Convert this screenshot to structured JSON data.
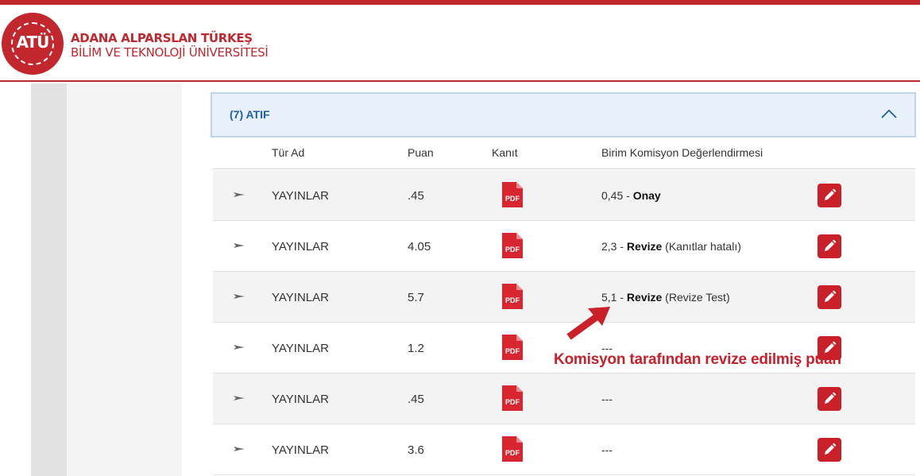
{
  "header": {
    "logo_text": "ATÜ",
    "university_line1": "ADANA ALPARSLAN TÜRKEŞ",
    "university_line2": "BİLİM VE TEKNOLOJİ ÜNİVERSİTESİ"
  },
  "panel": {
    "title": "(7) ATIF",
    "toggle_icon": "chevron-up-icon"
  },
  "table": {
    "columns": [
      "Tür Ad",
      "Puan",
      "Kanıt",
      "Birim Komisyon Değerlendirmesi"
    ],
    "rows": [
      {
        "tur": "YAYINLAR",
        "puan": ".45",
        "deg_value": "0,45",
        "deg_sep": " - ",
        "deg_status": "Onay",
        "deg_note": ""
      },
      {
        "tur": "YAYINLAR",
        "puan": "4.05",
        "deg_value": "2,3",
        "deg_sep": " - ",
        "deg_status": "Revize",
        "deg_note": " (Kanıtlar hatalı)"
      },
      {
        "tur": "YAYINLAR",
        "puan": "5.7",
        "deg_value": "5,1",
        "deg_sep": " - ",
        "deg_status": "Revize",
        "deg_note": " (Revize Test)"
      },
      {
        "tur": "YAYINLAR",
        "puan": "1.2",
        "deg_value": "---",
        "deg_sep": "",
        "deg_status": "",
        "deg_note": ""
      },
      {
        "tur": "YAYINLAR",
        "puan": ".45",
        "deg_value": "---",
        "deg_sep": "",
        "deg_status": "",
        "deg_note": ""
      },
      {
        "tur": "YAYINLAR",
        "puan": "3.6",
        "deg_value": "---",
        "deg_sep": "",
        "deg_status": "",
        "deg_note": ""
      }
    ],
    "pdf_label": "PDF"
  },
  "annotation": {
    "text": "Komisyon tarafından revize edilmiş puan"
  },
  "colors": {
    "brand_red": "#c1272d",
    "panel_blue": "#1f5fa8",
    "edit_red": "#c9202a"
  }
}
